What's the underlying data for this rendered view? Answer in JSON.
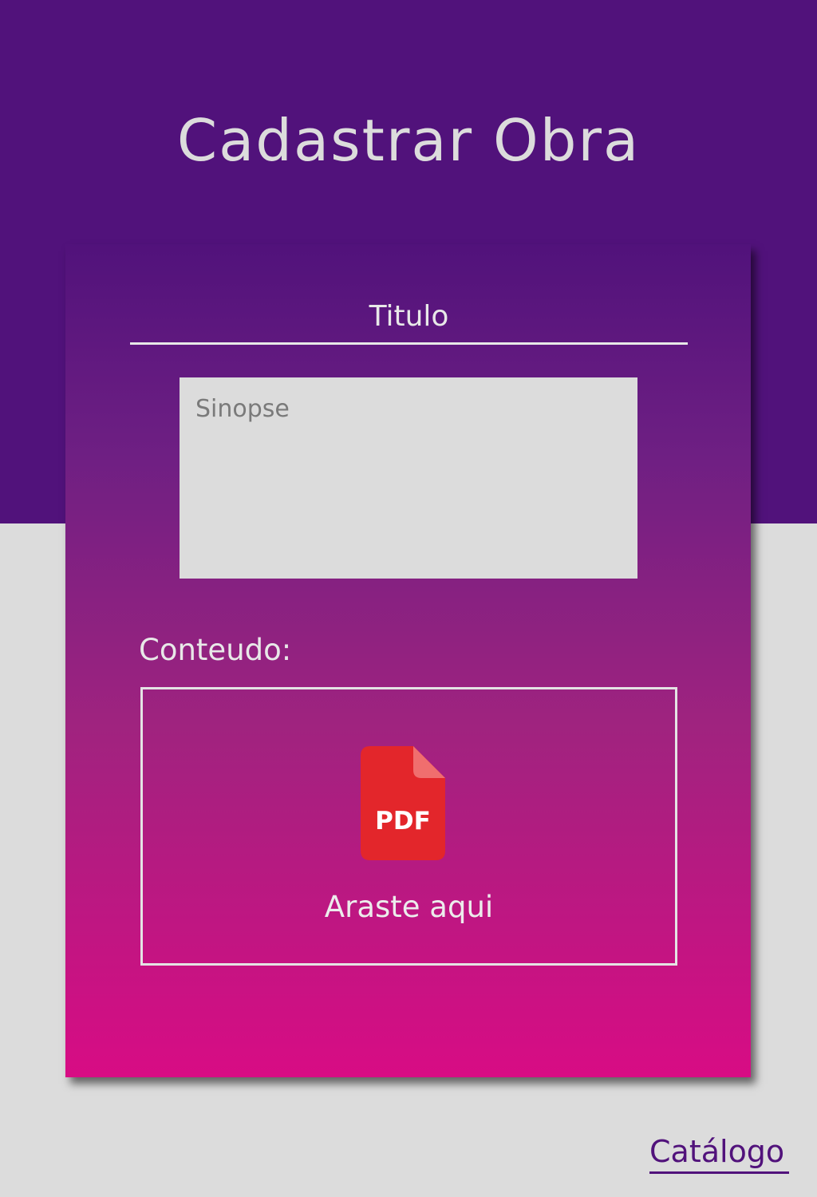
{
  "header": {
    "title": "Cadastrar Obra"
  },
  "form": {
    "title_placeholder": "Titulo",
    "synopsis_placeholder": "Sinopse",
    "content_label": "Conteudo:",
    "dropzone": {
      "icon": "pdf-file-icon",
      "icon_text": "PDF",
      "label": "Araste aqui"
    }
  },
  "footer": {
    "catalog_link": "Catálogo"
  },
  "colors": {
    "header_bg": "#51127b",
    "page_bg": "#dcdcdc",
    "card_gradient_top": "#51127b",
    "card_gradient_bottom": "#d80c84",
    "pdf_red": "#e3262b",
    "link": "#51127b"
  }
}
